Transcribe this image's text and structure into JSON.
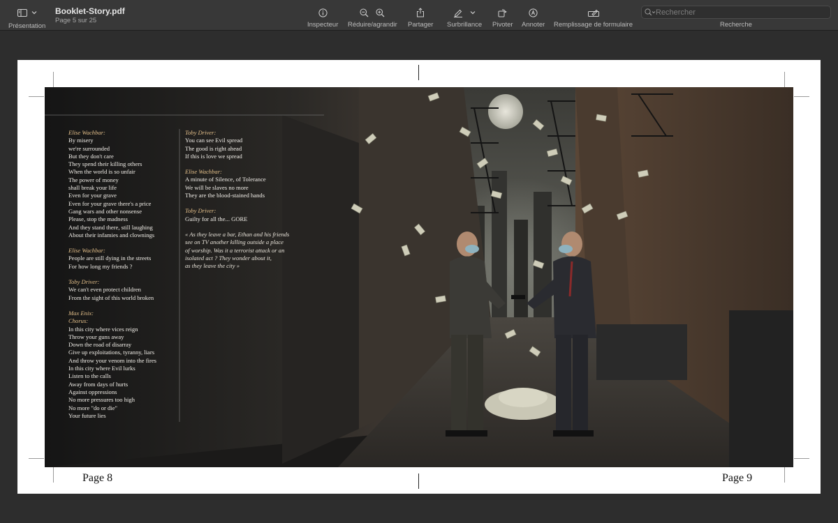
{
  "toolbar": {
    "view_label": "Présentation",
    "doc_name": "Booklet-Story.pdf",
    "page_info": "Page 5 sur 25",
    "inspector_label": "Inspecteur",
    "zoom_label": "Réduire/agrandir",
    "share_label": "Partager",
    "highlight_label": "Surbrillance",
    "rotate_label": "Pivoter",
    "annotate_label": "Annoter",
    "form_label": "Remplissage de formulaire",
    "search_placeholder": "Rechercher",
    "search_label": "Recherche"
  },
  "icons": [
    "sidebar-icon",
    "chevron-down-icon",
    "info-icon",
    "zoom-out-icon",
    "zoom-in-icon",
    "share-icon",
    "highlight-pen-icon",
    "rotate-icon",
    "annotate-icon",
    "form-fill-icon",
    "search-icon"
  ],
  "colors": {
    "toolbar": "#383838",
    "background": "#2d2d2d",
    "speaker": "#e3bf8a"
  },
  "spread": {
    "left_col": [
      {
        "speaker": "Elise Wachbar:",
        "lines": [
          "By misery",
          "we're surrounded",
          "But they don't care",
          "They spend their killing others",
          "When the world is so unfair",
          "The power of money",
          "shall break your life",
          "Even for your grave",
          "Even for your grave there's a price",
          "Gang wars and other nonsense",
          "Please, stop the madness",
          "And they stand there, still laughing",
          "About their infamies and clownings"
        ]
      },
      {
        "speaker": "Elise Wachbar:",
        "lines": [
          "People are still dying in the streets",
          "For how long my friends ?"
        ]
      },
      {
        "speaker": "Toby Driver:",
        "lines": [
          "We can't even protect children",
          "From the sight of this world broken"
        ]
      },
      {
        "speaker": "Max Enix:",
        "sub": "Chorus:",
        "lines": [
          "In this city where vices reign",
          "Throw your guns away",
          "Down the road of disarray",
          "Give up  exploitations, tyranny, liars",
          "And throw your venom into the fires",
          "In this city where Evil lurks",
          "Listen to the calls",
          "Away from days of hurts",
          "Against oppressions",
          "No more pressures too high",
          "No more \"do or die\"",
          "Your future lies"
        ]
      }
    ],
    "right_col": [
      {
        "speaker": "Toby Driver:",
        "lines": [
          "You can see Evil spread",
          "The good is right ahead",
          "If this is love we spread"
        ]
      },
      {
        "speaker": "Elise Wachbar:",
        "lines": [
          "A minute of Silence, of Tolerance",
          "We will be slaves no more",
          "They are the blood-stained hands"
        ]
      },
      {
        "speaker": "Toby Driver:",
        "lines": [
          "Guilty for all the... GORE"
        ]
      }
    ],
    "narration": [
      "« As they leave a bar, Ethan and his friends",
      "see on TV  another killing outside a place",
      "of worship. Was it a terrorist attack or an",
      "isolated act ? They wonder about it,",
      "as they leave the city »"
    ],
    "page_left": "Page 8",
    "page_right": "Page 9"
  }
}
